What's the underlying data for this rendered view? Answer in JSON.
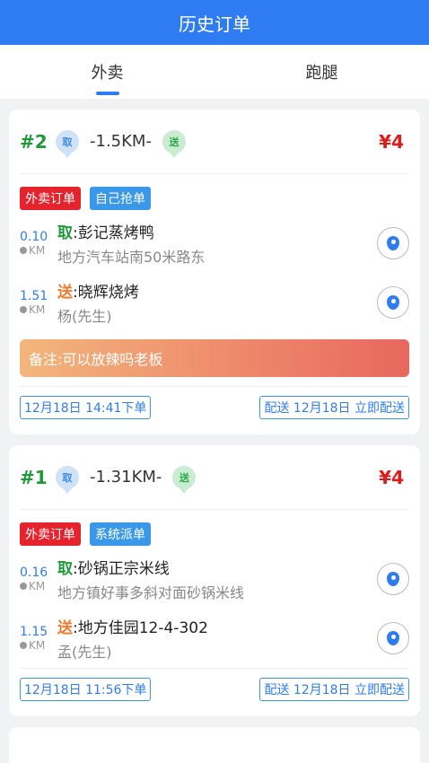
{
  "title": "历史订单",
  "tabs": [
    {
      "label": "外卖",
      "active": true
    },
    {
      "label": "跑腿",
      "active": false
    }
  ],
  "orders": [
    {
      "number": "#2",
      "pickup_badge": "取",
      "distance": "-1.5KM-",
      "deliver_badge": "送",
      "price": "¥4",
      "tags": [
        "外卖订单",
        "自己抢单"
      ],
      "pickup": {
        "km": "0.10",
        "unit": "KM",
        "prefix": "取",
        "name": ":彭记蒸烤鸭",
        "address": "地方汽车站南50米路东"
      },
      "deliver": {
        "km": "1.51",
        "unit": "KM",
        "prefix": "送",
        "name": ":晓辉烧烤",
        "contact": "杨(先生)"
      },
      "note": "备注:可以放辣吗老板",
      "order_time": "12月18日 14:41下单",
      "delivery_time": "配送 12月18日 立即配送"
    },
    {
      "number": "#1",
      "pickup_badge": "取",
      "distance": "-1.31KM-",
      "deliver_badge": "送",
      "price": "¥4",
      "tags": [
        "外卖订单",
        "系统派单"
      ],
      "pickup": {
        "km": "0.16",
        "unit": "KM",
        "prefix": "取",
        "name": ":砂锅正宗米线",
        "address": "地方镇好事多斜对面砂锅米线"
      },
      "deliver": {
        "km": "1.15",
        "unit": "KM",
        "prefix": "送",
        "name": ":地方佳园12-4-302",
        "contact": "孟(先生)"
      },
      "order_time": "12月18日 11:56下单",
      "delivery_time": "配送 12月18日 立即配送"
    }
  ],
  "colors": {
    "primary": "#2f7cf2",
    "price": "#e01b1b",
    "number": "#1f9a3a"
  }
}
